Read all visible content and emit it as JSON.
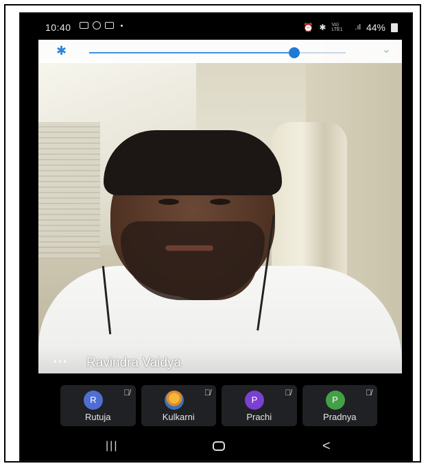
{
  "status_bar": {
    "time": "10:40",
    "network_label": "Vo) LTE1",
    "battery": "44%"
  },
  "audio_control": {
    "slider_level": 0.8,
    "bluetooth_icon": "bluetooth-icon",
    "collapse_icon": "chevron-down-icon"
  },
  "main_video": {
    "more_label": "···",
    "participant_name": "Ravindra Vaidya"
  },
  "participants": [
    {
      "initial": "R",
      "name": "Rutuja",
      "avatar_color": "#4f6ed1"
    },
    {
      "initial": "",
      "name": "Kulkarni",
      "avatar_color": "#e08a2a"
    },
    {
      "initial": "P",
      "name": "Prachi",
      "avatar_color": "#7b3fd1"
    },
    {
      "initial": "P",
      "name": "Pradnya",
      "avatar_color": "#43a047"
    }
  ],
  "nav": {
    "recents": "|||",
    "back": "<"
  }
}
